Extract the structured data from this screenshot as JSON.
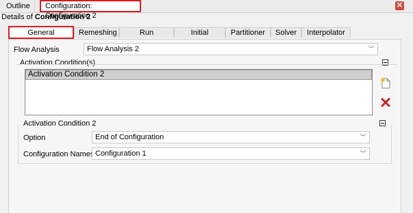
{
  "top_tabs": {
    "outline": "Outline",
    "configuration": "Configuration: Configuration 2"
  },
  "details": {
    "prefix": "Details of ",
    "name": "Configuration 2"
  },
  "settings_tabs": [
    "General Settings",
    "Remeshing",
    "Run Definition",
    "Initial Values",
    "Partitioner",
    "Solver",
    "Interpolator"
  ],
  "flow_analysis": {
    "label": "Flow Analysis",
    "value": "Flow Analysis 2"
  },
  "activation_conditions": {
    "title": "Activation Condition(s)",
    "items": [
      "Activation Condition 2"
    ]
  },
  "activation_condition": {
    "title": "Activation Condition 2",
    "option_label": "Option",
    "option_value": "End of Configuration",
    "names_label": "Configuration Names",
    "names_value": "Configuration 1"
  },
  "icons": {
    "close": "close-icon",
    "new": "new-item-icon",
    "delete": "delete-icon",
    "chevron": "chevron-down-icon"
  },
  "colors": {
    "highlight": "#e0191f",
    "delete": "#d0201a"
  }
}
